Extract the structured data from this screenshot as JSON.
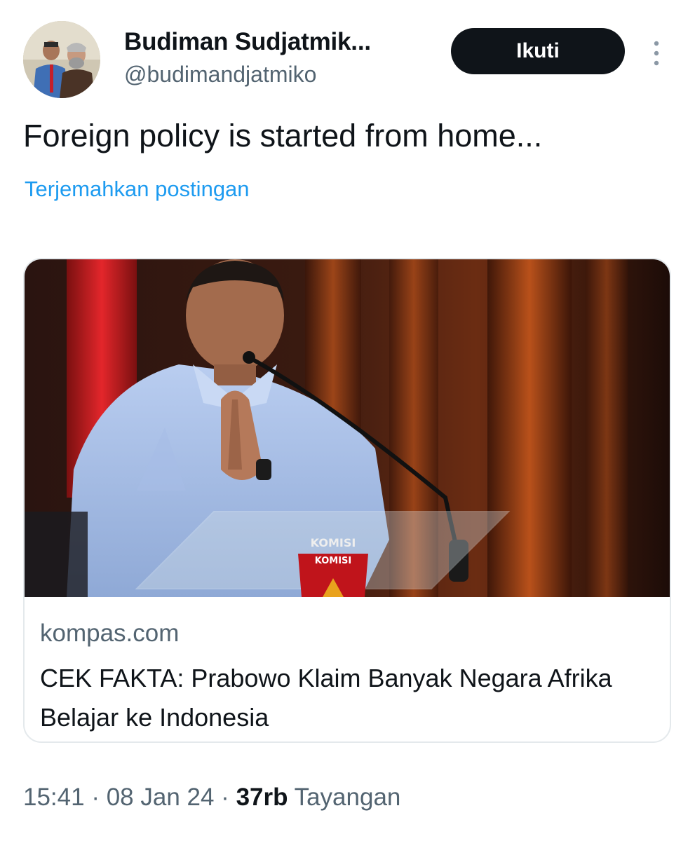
{
  "author": {
    "display_name": "Budiman Sudjatmik...",
    "handle": "@budimandjatmiko"
  },
  "actions": {
    "follow_label": "Ikuti",
    "more_icon": "more-vertical-icon"
  },
  "tweet": {
    "text": "Foreign policy is started from home...",
    "translate_label": "Terjemahkan postingan"
  },
  "card": {
    "domain": "kompas.com",
    "title": "CEK FAKTA: Prabowo Klaim Banyak Negara Afrika Belajar ke Indonesia",
    "image_podium_text_top": "KOMISI",
    "image_podium_text_bottom": "KOMISI"
  },
  "meta": {
    "time": "15:41",
    "separator_1": " · ",
    "date": "08 Jan 24",
    "separator_2": " · ",
    "views_count": "37rb",
    "views_label": " Tayangan"
  },
  "colors": {
    "accent": "#1d9bf0",
    "text_primary": "#0f1419",
    "text_secondary": "#536471",
    "button_bg": "#0f1419"
  }
}
